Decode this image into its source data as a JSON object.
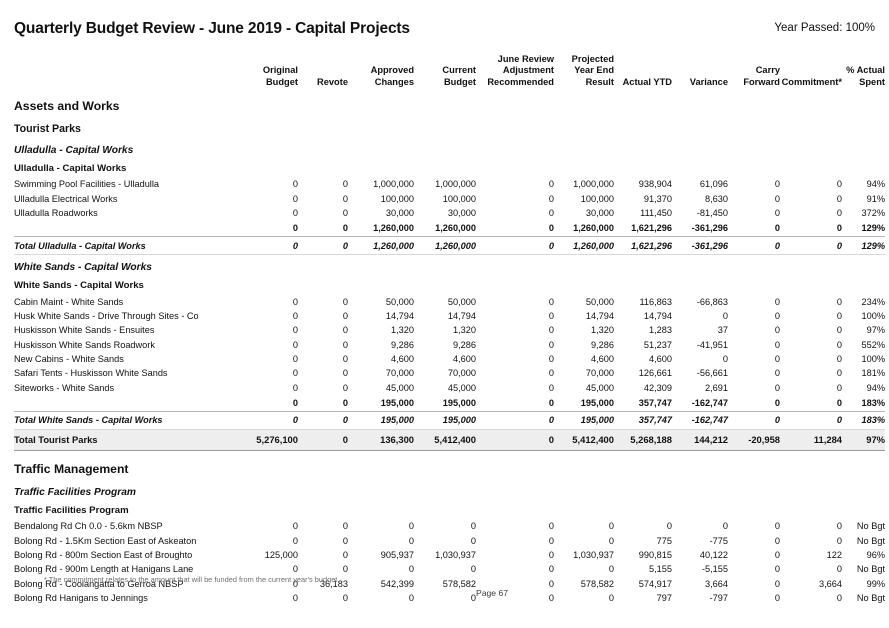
{
  "document": {
    "title": "Quarterly Budget Review - June 2019 - Capital Projects",
    "year_passed": "Year Passed: 100%",
    "footnote": "* The commitment relates to the amount that will be funded from the current year's budget",
    "page_number": "Page 67"
  },
  "columns": {
    "label": "",
    "original_budget": "Original Budget",
    "revote": "Revote",
    "approved_changes": "Approved Changes",
    "current_budget": "Current Budget",
    "june_review": "June Review Adjustment Recommended",
    "projected_year_end": "Projected Year End Result",
    "actual_ytd": "Actual YTD",
    "variance": "Variance",
    "carry_forward": "Carry Forward",
    "commitment": "Commitment*",
    "percent_actual_spent": "% Actual Spent"
  },
  "rows": [
    {
      "type": "dept",
      "indent": 0,
      "label": "Assets and Works",
      "values": [
        "",
        "",
        "",
        "",
        "",
        "",
        "",
        "",
        "",
        "",
        ""
      ]
    },
    {
      "type": "prog",
      "indent": 1,
      "label": "Tourist Parks",
      "values": [
        "",
        "",
        "",
        "",
        "",
        "",
        "",
        "",
        "",
        "",
        ""
      ]
    },
    {
      "type": "group",
      "indent": 2,
      "label": "Ulladulla - Capital Works",
      "values": [
        "",
        "",
        "",
        "",
        "",
        "",
        "",
        "",
        "",
        "",
        ""
      ]
    },
    {
      "type": "subgroup",
      "indent": 2,
      "label": "Ulladulla - Capital Works",
      "values": [
        "",
        "",
        "",
        "",
        "",
        "",
        "",
        "",
        "",
        "",
        ""
      ]
    },
    {
      "type": "detail",
      "indent": 3,
      "label": "Swimming Pool Facilities - Ulladulla",
      "values": [
        "0",
        "0",
        "1,000,000",
        "1,000,000",
        "0",
        "1,000,000",
        "938,904",
        "61,096",
        "0",
        "0",
        "94%"
      ]
    },
    {
      "type": "detail",
      "indent": 3,
      "label": "Ulladulla Electrical Works",
      "values": [
        "0",
        "0",
        "100,000",
        "100,000",
        "0",
        "100,000",
        "91,370",
        "8,630",
        "0",
        "0",
        "91%"
      ]
    },
    {
      "type": "detail",
      "indent": 3,
      "label": "Ulladulla Roadworks",
      "values": [
        "0",
        "0",
        "30,000",
        "30,000",
        "0",
        "30,000",
        "111,450",
        "-81,450",
        "0",
        "0",
        "372%"
      ]
    },
    {
      "type": "sum",
      "indent": 3,
      "label": "",
      "values": [
        "0",
        "0",
        "1,260,000",
        "1,260,000",
        "0",
        "1,260,000",
        "1,621,296",
        "-361,296",
        "0",
        "0",
        "129%"
      ]
    },
    {
      "type": "total",
      "indent": 2,
      "label": "Total Ulladulla - Capital Works",
      "values": [
        "0",
        "0",
        "1,260,000",
        "1,260,000",
        "0",
        "1,260,000",
        "1,621,296",
        "-361,296",
        "0",
        "0",
        "129%"
      ]
    },
    {
      "type": "group",
      "indent": 2,
      "label": "White Sands - Capital Works",
      "values": [
        "",
        "",
        "",
        "",
        "",
        "",
        "",
        "",
        "",
        "",
        ""
      ]
    },
    {
      "type": "subgroup",
      "indent": 2,
      "label": "White Sands - Capital Works",
      "values": [
        "",
        "",
        "",
        "",
        "",
        "",
        "",
        "",
        "",
        "",
        ""
      ]
    },
    {
      "type": "detail",
      "indent": 3,
      "label": "Cabin Maint - White Sands",
      "values": [
        "0",
        "0",
        "50,000",
        "50,000",
        "0",
        "50,000",
        "116,863",
        "-66,863",
        "0",
        "0",
        "234%"
      ]
    },
    {
      "type": "detail",
      "indent": 3,
      "label": "Husk White Sands - Drive Through Sites - Co",
      "values": [
        "0",
        "0",
        "14,794",
        "14,794",
        "0",
        "14,794",
        "14,794",
        "0",
        "0",
        "0",
        "100%"
      ]
    },
    {
      "type": "detail",
      "indent": 3,
      "label": "Huskisson White Sands - Ensuites",
      "values": [
        "0",
        "0",
        "1,320",
        "1,320",
        "0",
        "1,320",
        "1,283",
        "37",
        "0",
        "0",
        "97%"
      ]
    },
    {
      "type": "detail",
      "indent": 3,
      "label": "Huskisson White Sands Roadwork",
      "values": [
        "0",
        "0",
        "9,286",
        "9,286",
        "0",
        "9,286",
        "51,237",
        "-41,951",
        "0",
        "0",
        "552%"
      ]
    },
    {
      "type": "detail",
      "indent": 3,
      "label": "New Cabins - White Sands",
      "values": [
        "0",
        "0",
        "4,600",
        "4,600",
        "0",
        "4,600",
        "4,600",
        "0",
        "0",
        "0",
        "100%"
      ]
    },
    {
      "type": "detail",
      "indent": 3,
      "label": "Safari Tents - Huskisson White Sands",
      "values": [
        "0",
        "0",
        "70,000",
        "70,000",
        "0",
        "70,000",
        "126,661",
        "-56,661",
        "0",
        "0",
        "181%"
      ]
    },
    {
      "type": "detail",
      "indent": 3,
      "label": "Siteworks - White Sands",
      "values": [
        "0",
        "0",
        "45,000",
        "45,000",
        "0",
        "45,000",
        "42,309",
        "2,691",
        "0",
        "0",
        "94%"
      ]
    },
    {
      "type": "sum",
      "indent": 3,
      "label": "",
      "values": [
        "0",
        "0",
        "195,000",
        "195,000",
        "0",
        "195,000",
        "357,747",
        "-162,747",
        "0",
        "0",
        "183%"
      ]
    },
    {
      "type": "total",
      "indent": 2,
      "label": "Total White Sands - Capital Works",
      "values": [
        "0",
        "0",
        "195,000",
        "195,000",
        "0",
        "195,000",
        "357,747",
        "-162,747",
        "0",
        "0",
        "183%"
      ]
    },
    {
      "type": "grand",
      "indent": 0,
      "label": "Total Tourist Parks",
      "values": [
        "5,276,100",
        "0",
        "136,300",
        "5,412,400",
        "0",
        "5,412,400",
        "5,268,188",
        "144,212",
        "-20,958",
        "11,284",
        "97%"
      ]
    },
    {
      "type": "dept",
      "indent": 0,
      "label": "Traffic Management",
      "values": [
        "",
        "",
        "",
        "",
        "",
        "",
        "",
        "",
        "",
        "",
        ""
      ]
    },
    {
      "type": "group",
      "indent": 2,
      "label": "Traffic Facilities Program",
      "values": [
        "",
        "",
        "",
        "",
        "",
        "",
        "",
        "",
        "",
        "",
        ""
      ]
    },
    {
      "type": "subgroup",
      "indent": 2,
      "label": "Traffic Facilities Program",
      "values": [
        "",
        "",
        "",
        "",
        "",
        "",
        "",
        "",
        "",
        "",
        ""
      ]
    },
    {
      "type": "detail",
      "indent": 3,
      "label": "Bendalong Rd Ch 0.0 - 5.6km NBSP",
      "values": [
        "0",
        "0",
        "0",
        "0",
        "0",
        "0",
        "0",
        "0",
        "0",
        "0",
        "No Bgt"
      ]
    },
    {
      "type": "detail",
      "indent": 3,
      "label": "Bolong Rd - 1.5Km Section East of Askeaton",
      "values": [
        "0",
        "0",
        "0",
        "0",
        "0",
        "0",
        "775",
        "-775",
        "0",
        "0",
        "No Bgt"
      ]
    },
    {
      "type": "detail",
      "indent": 3,
      "label": "Bolong Rd - 800m Section East of Broughto",
      "values": [
        "125,000",
        "0",
        "905,937",
        "1,030,937",
        "0",
        "1,030,937",
        "990,815",
        "40,122",
        "0",
        "122",
        "96%"
      ]
    },
    {
      "type": "detail",
      "indent": 3,
      "label": "Bolong Rd - 900m Length at Hanigans Lane",
      "values": [
        "0",
        "0",
        "0",
        "0",
        "0",
        "0",
        "5,155",
        "-5,155",
        "0",
        "0",
        "No Bgt"
      ]
    },
    {
      "type": "detail",
      "indent": 3,
      "label": "Bolong Rd - Coolangatta to Gerroa NBSP",
      "values": [
        "0",
        "36,183",
        "542,399",
        "578,582",
        "0",
        "578,582",
        "574,917",
        "3,664",
        "0",
        "3,664",
        "99%"
      ]
    },
    {
      "type": "detail",
      "indent": 3,
      "label": "Bolong Rd Hanigans to Jennings",
      "values": [
        "0",
        "0",
        "0",
        "0",
        "0",
        "0",
        "797",
        "-797",
        "0",
        "0",
        "No Bgt"
      ]
    }
  ]
}
